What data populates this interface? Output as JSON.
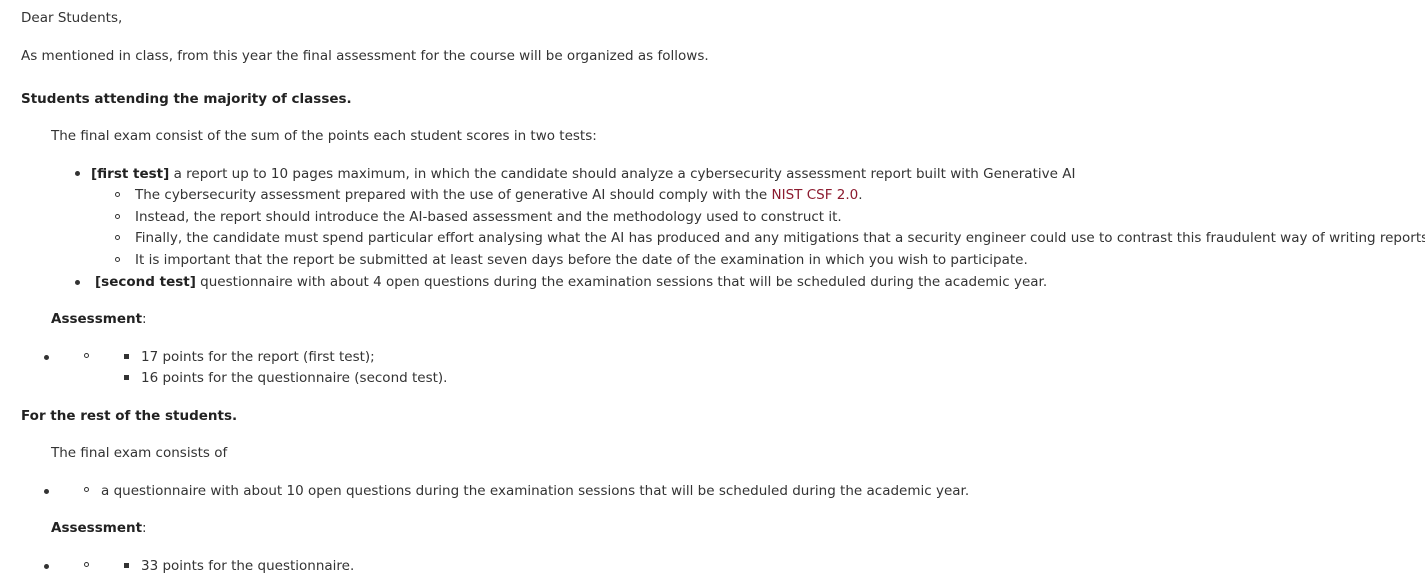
{
  "greeting": "Dear Students,",
  "intro": "As mentioned in class, from this year the final assessment for the course will be organized as follows.",
  "attending": {
    "heading": "Students attending the majority of classes.",
    "description": "The final exam consist of the sum of the points each student scores in two tests:",
    "first_test": {
      "tag": "[first test]",
      "text": " a report up to 10 pages maximum, in which the candidate should analyze a cybersecurity assessment report built with Generative AI",
      "subitems": {
        "item1_before": "The cybersecurity assessment prepared with the use of generative AI should comply with the ",
        "item1_link": "NIST CSF 2.0",
        "item1_after": ".",
        "item2": "Instead, the report should introduce the AI-based assessment and the methodology used to construct it.",
        "item3": "Finally, the candidate must spend particular effort analysing what the AI has produced and any mitigations that a security engineer could use to contrast this fraudulent way of writing reports.",
        "item4": "It is important that the report be submitted at least seven days before the date of the examination in which you wish to participate."
      }
    },
    "second_test": {
      "tag": "[second test]",
      "text": " questionnaire with about 4 open questions during the examination sessions that will be scheduled during the academic year."
    },
    "assessment_label": "Assessment",
    "assessment_colon": ":",
    "assessment_items": [
      "17 points for the report (first test);",
      "16 points for the questionnaire (second test)."
    ]
  },
  "others": {
    "heading": "For the rest of the students.",
    "description": "The final exam consists of",
    "item": "a questionnaire with about 10 open questions during the examination sessions that will be scheduled during the academic year.",
    "assessment_label": "Assessment",
    "assessment_colon": ":",
    "assessment_item": "33 points for the questionnaire."
  },
  "colors": {
    "text": "#333333",
    "link": "#8b1a2e",
    "background": "#ffffff"
  }
}
